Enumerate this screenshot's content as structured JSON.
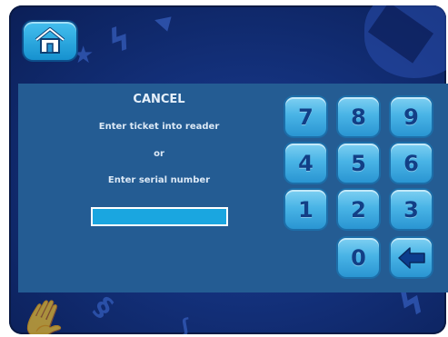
{
  "screen": {
    "title": "CANCEL",
    "instruction_1": "Enter ticket into reader",
    "or_label": "or",
    "instruction_2": "Enter serial number",
    "serial_value": ""
  },
  "keypad": {
    "rows": [
      [
        "7",
        "8",
        "9"
      ],
      [
        "4",
        "5",
        "6"
      ],
      [
        "1",
        "2",
        "3"
      ],
      [
        "0"
      ]
    ],
    "backspace_icon": "left-arrow-icon"
  },
  "home_icon": "house-icon",
  "colors": {
    "background": "#13307a",
    "panel": "#245c93",
    "key_face": "#49b4e6",
    "key_text": "#123f86",
    "input_fill": "#1aa6e0",
    "text": "#dbe8f5"
  }
}
